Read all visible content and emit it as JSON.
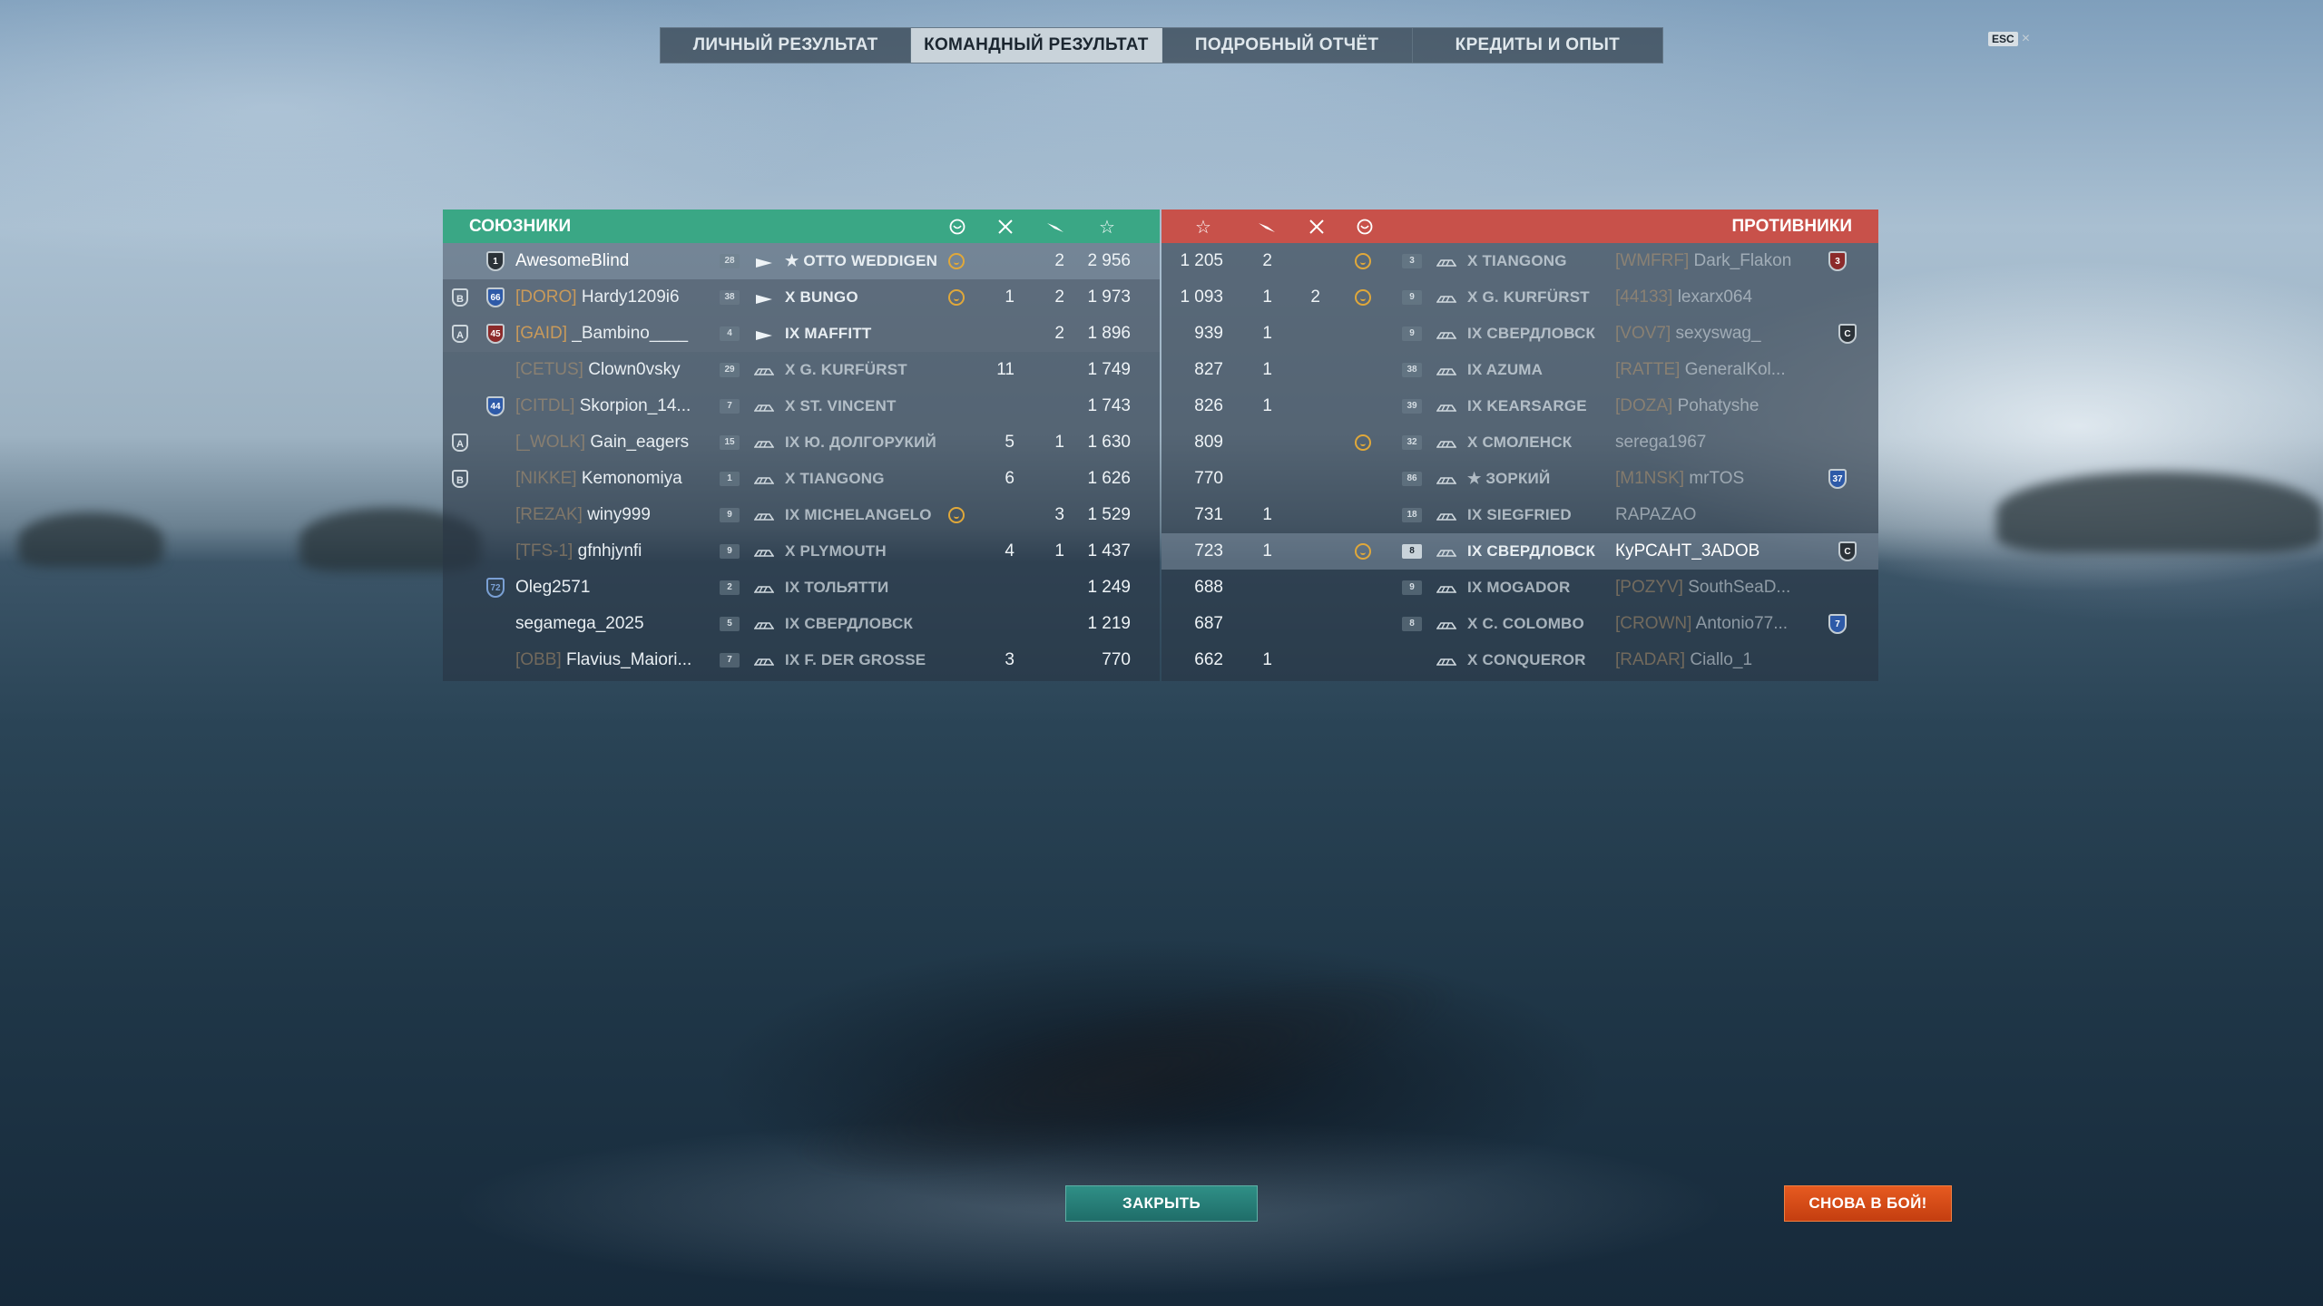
{
  "tabs": [
    {
      "label": "ЛИЧНЫЙ РЕЗУЛЬТАТ"
    },
    {
      "label": "КОМАНДНЫЙ РЕЗУЛЬТАТ"
    },
    {
      "label": "ПОДРОБНЫЙ ОТЧЁТ"
    },
    {
      "label": "КРЕДИТЫ И ОПЫТ"
    }
  ],
  "active_tab": 1,
  "esc": {
    "key": "ESC",
    "close": "×"
  },
  "allies": {
    "title": "СОЮЗНИКИ",
    "color": "#3aa785",
    "rows": [
      {
        "div": "",
        "rank": "1",
        "clan": "",
        "name": "AwesomeBlind",
        "lvl": "28",
        "ship": "★ OTTO WEDDIGEN",
        "medal": true,
        "kills": "",
        "planes": "2",
        "xp": "2 956"
      },
      {
        "div": "B",
        "rank": "66",
        "clan": "[DORO]",
        "name": "Hardy1209i6",
        "lvl": "38",
        "ship": "X BUNGO",
        "medal": true,
        "kills": "1",
        "planes": "2",
        "xp": "1 973"
      },
      {
        "div": "A",
        "rank": "45",
        "clan": "[GAID]",
        "name": "_Bambino____",
        "lvl": "4",
        "ship": "IX MAFFITT",
        "medal": false,
        "kills": "",
        "planes": "2",
        "xp": "1 896"
      },
      {
        "div": "",
        "rank": "",
        "clan": "[CETUS]",
        "name": "Clown0vsky",
        "lvl": "29",
        "ship": "X G. KURFÜRST",
        "medal": false,
        "kills": "11",
        "planes": "",
        "xp": "1 749"
      },
      {
        "div": "",
        "rank": "44",
        "clan": "[CITDL]",
        "name": "Skorpion_14...",
        "lvl": "7",
        "ship": "X ST. VINCENT",
        "medal": false,
        "kills": "",
        "planes": "",
        "xp": "1 743"
      },
      {
        "div": "A",
        "rank": "",
        "clan": "[_WOLK]",
        "name": "Gain_eagers",
        "lvl": "15",
        "ship": "IX Ю. ДОЛГОРУКИЙ",
        "medal": false,
        "kills": "5",
        "planes": "1",
        "xp": "1 630"
      },
      {
        "div": "B",
        "rank": "",
        "clan": "[NIKKE]",
        "name": "Kemonomiya",
        "lvl": "1",
        "ship": "X TIANGONG",
        "medal": false,
        "kills": "6",
        "planes": "",
        "xp": "1 626"
      },
      {
        "div": "",
        "rank": "",
        "clan": "[REZAK]",
        "name": "winy999",
        "lvl": "9",
        "ship": "IX MICHELANGELO",
        "medal": true,
        "kills": "",
        "planes": "3",
        "xp": "1 529"
      },
      {
        "div": "",
        "rank": "",
        "clan": "[TFS-1]",
        "name": "gfnhjynfi",
        "lvl": "9",
        "ship": "X PLYMOUTH",
        "medal": false,
        "kills": "4",
        "planes": "1",
        "xp": "1 437"
      },
      {
        "div": "",
        "rank": "72",
        "clan": "",
        "name": "Oleg2571",
        "lvl": "2",
        "ship": "IX ТОЛЬЯТТИ",
        "medal": false,
        "kills": "",
        "planes": "",
        "xp": "1 249"
      },
      {
        "div": "",
        "rank": "",
        "clan": "",
        "name": "segamega_2025",
        "lvl": "5",
        "ship": "IX СВЕРДЛОВСК",
        "medal": false,
        "kills": "",
        "planes": "",
        "xp": "1 219"
      },
      {
        "div": "",
        "rank": "",
        "clan": "[OBB]",
        "name": "Flavius_Maiori...",
        "lvl": "7",
        "ship": "IX F. DER GROSSE",
        "medal": false,
        "kills": "3",
        "planes": "",
        "xp": "770"
      }
    ]
  },
  "enemies": {
    "title": "ПРОТИВНИКИ",
    "color": "#c8514a",
    "rows": [
      {
        "xp": "1 205",
        "planes": "2",
        "kills": "",
        "medal": true,
        "lvl": "3",
        "ship": "X TIANGONG",
        "clan": "[WMFRF]",
        "name": "Dark_Flakon",
        "rank": "3"
      },
      {
        "xp": "1 093",
        "planes": "1",
        "kills": "2",
        "medal": true,
        "lvl": "9",
        "ship": "X G. KURFÜRST",
        "clan": "[44133]",
        "name": "lexarx064",
        "rank": ""
      },
      {
        "xp": "939",
        "planes": "1",
        "kills": "",
        "medal": false,
        "lvl": "9",
        "ship": "IX СВЕРДЛОВСК",
        "clan": "[VOV7]",
        "name": "sexyswag_",
        "rank": "C"
      },
      {
        "xp": "827",
        "planes": "1",
        "kills": "",
        "medal": false,
        "lvl": "38",
        "ship": "IX AZUMA",
        "clan": "[RATTE]",
        "name": "GeneralKol...",
        "rank": ""
      },
      {
        "xp": "826",
        "planes": "1",
        "kills": "",
        "medal": false,
        "lvl": "39",
        "ship": "IX KEARSARGE",
        "clan": "[DOZA]",
        "name": "Pohatyshe",
        "rank": ""
      },
      {
        "xp": "809",
        "planes": "",
        "kills": "",
        "medal": true,
        "lvl": "32",
        "ship": "X СМОЛЕНСК",
        "clan": "",
        "name": "serega1967",
        "rank": ""
      },
      {
        "xp": "770",
        "planes": "",
        "kills": "",
        "medal": false,
        "lvl": "86",
        "ship": "★ ЗОРКИЙ",
        "clan": "[M1NSK]",
        "name": "mrTOS",
        "rank": "37"
      },
      {
        "xp": "731",
        "planes": "1",
        "kills": "",
        "medal": false,
        "lvl": "18",
        "ship": "IX SIEGFRIED",
        "clan": "",
        "name": "RAPAZAO",
        "rank": ""
      },
      {
        "xp": "723",
        "planes": "1",
        "kills": "",
        "medal": true,
        "lvl": "8",
        "ship": "IX СВЕРДЛОВСК",
        "clan": "",
        "name": "КуРСАНТ_3АDОВ",
        "rank": "C"
      },
      {
        "xp": "688",
        "planes": "",
        "kills": "",
        "medal": false,
        "lvl": "9",
        "ship": "IX MOGADOR",
        "clan": "[POZYV]",
        "name": "SouthSeaD...",
        "rank": ""
      },
      {
        "xp": "687",
        "planes": "",
        "kills": "",
        "medal": false,
        "lvl": "8",
        "ship": "X C. COLOMBO",
        "clan": "[CROWN]",
        "name": "Antonio77...",
        "rank": "7"
      },
      {
        "xp": "662",
        "planes": "1",
        "kills": "",
        "medal": false,
        "lvl": "",
        "ship": "X CONQUEROR",
        "clan": "[RADAR]",
        "name": "Ciallo_1",
        "rank": ""
      }
    ]
  },
  "buttons": {
    "close": "ЗАКРЫТЬ",
    "again": "СНОВА В БОЙ!"
  }
}
